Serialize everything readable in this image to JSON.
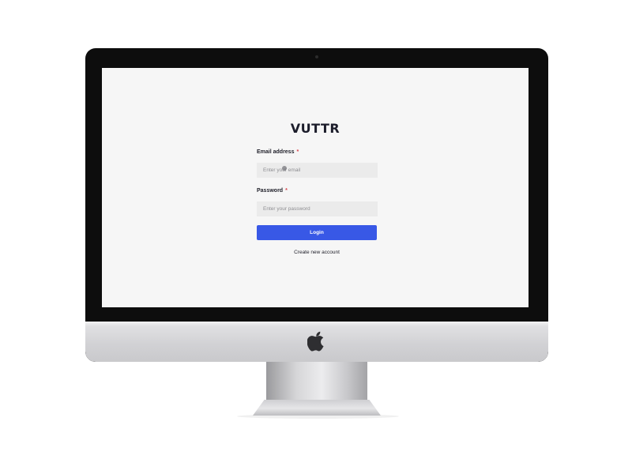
{
  "app": {
    "title": "VUTTR"
  },
  "form": {
    "email": {
      "label": "Email address",
      "required_mark": "*",
      "placeholder": "Enter your email",
      "value": ""
    },
    "password": {
      "label": "Password",
      "required_mark": "*",
      "placeholder": "Enter your password",
      "value": ""
    },
    "submit_label": "Login",
    "create_account_label": "Create new account"
  },
  "device": {
    "logo_icon": "apple-icon"
  },
  "colors": {
    "primary_button": "#3858e6",
    "required_mark": "#d8434a",
    "screen_background": "#f6f6f6",
    "input_background": "#ebebeb",
    "monitor_bezel": "#0d0d0d"
  }
}
